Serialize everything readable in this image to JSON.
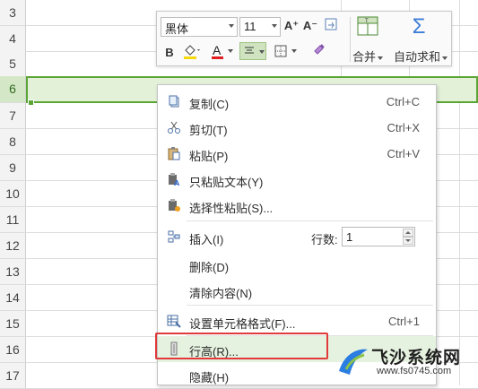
{
  "sheet": {
    "rows": [
      "3",
      "4",
      "5",
      "6",
      "7",
      "8",
      "9",
      "10",
      "11",
      "12",
      "13",
      "14",
      "15",
      "16",
      "17"
    ],
    "selected_row": "6"
  },
  "mini_toolbar": {
    "font_name": "黑体",
    "font_size": "11",
    "increase_font_icon": "A⁺",
    "decrease_font_icon": "A⁻",
    "bold_label": "B",
    "font_color_label": "A",
    "merge_label": "合并",
    "autosum_label": "自动求和",
    "autosum_symbol": "Σ"
  },
  "context_menu": {
    "items": [
      {
        "label": "复制(C)",
        "shortcut": "Ctrl+C",
        "icon": "copy-icon"
      },
      {
        "label": "剪切(T)",
        "shortcut": "Ctrl+X",
        "icon": "scissors-icon"
      },
      {
        "label": "粘贴(P)",
        "shortcut": "Ctrl+V",
        "icon": "paste-icon"
      },
      {
        "label": "只粘贴文本(Y)",
        "shortcut": "",
        "icon": "paste-text-icon"
      },
      {
        "label": "选择性粘贴(S)...",
        "shortcut": "",
        "icon": "paste-special-icon"
      },
      {
        "label": "插入(I)",
        "shortcut": "",
        "icon": "insert-rows-icon"
      },
      {
        "label": "删除(D)",
        "shortcut": "",
        "icon": ""
      },
      {
        "label": "清除内容(N)",
        "shortcut": "",
        "icon": ""
      },
      {
        "label": "设置单元格格式(F)...",
        "shortcut": "Ctrl+1",
        "icon": "format-cells-icon"
      },
      {
        "label": "行高(R)...",
        "shortcut": "",
        "icon": "row-height-icon"
      },
      {
        "label": "隐藏(H)",
        "shortcut": "",
        "icon": ""
      }
    ],
    "rows_count_label": "行数:",
    "rows_count_value": "1"
  },
  "colors": {
    "selection": "#5aa536",
    "highlight_box": "#e03a3a",
    "font_color_bar": "#e02020",
    "fill_color_bar": "#f5d90a"
  },
  "watermark": {
    "title": "飞沙系统网",
    "url": "www.fs0745.com"
  }
}
